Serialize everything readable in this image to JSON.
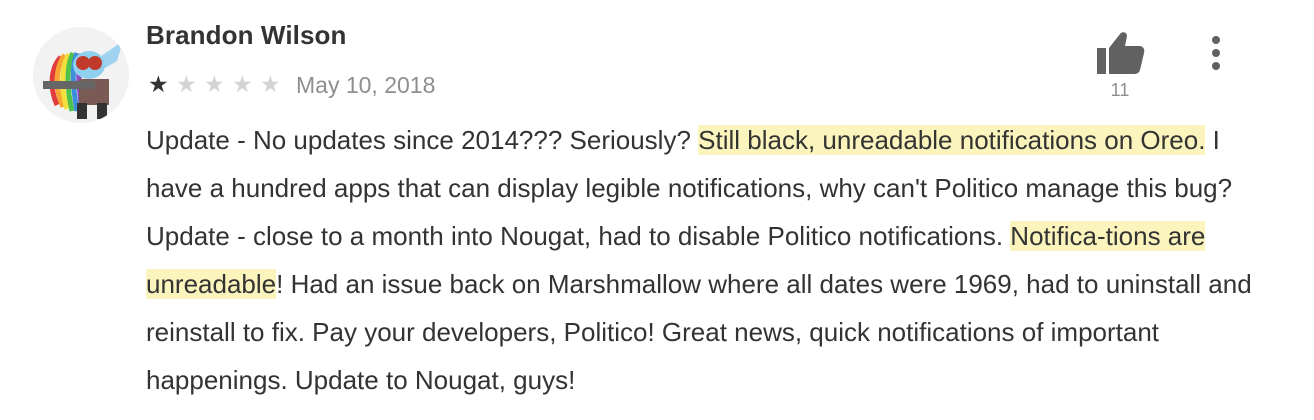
{
  "review": {
    "author_name": "Brandon Wilson",
    "avatar_icon": "pony-avatar-icon",
    "rating": 1,
    "rating_max": 5,
    "date": "May 10, 2018",
    "like_icon": "thumbs-up-icon",
    "like_count": "11",
    "menu_icon": "more-vert-icon",
    "highlight_color": "#fbf5bd",
    "text_segments": [
      "Update - No updates since 2014??? Seriously? ",
      "Still black, unreadable notifications on Oreo.",
      " I have a hundred apps that can display legible notifications, why can't Politico manage this bug? Update - close to a month into Nougat, had to disable Politico notifications. ",
      "Notifica-tions are unreadable",
      "! Had an issue back on Marshmallow where all dates were 1969, had to uninstall and reinstall to fix. Pay your developers, Politico! Great news, quick notifications of important happenings. Update to Nougat, guys!"
    ]
  }
}
